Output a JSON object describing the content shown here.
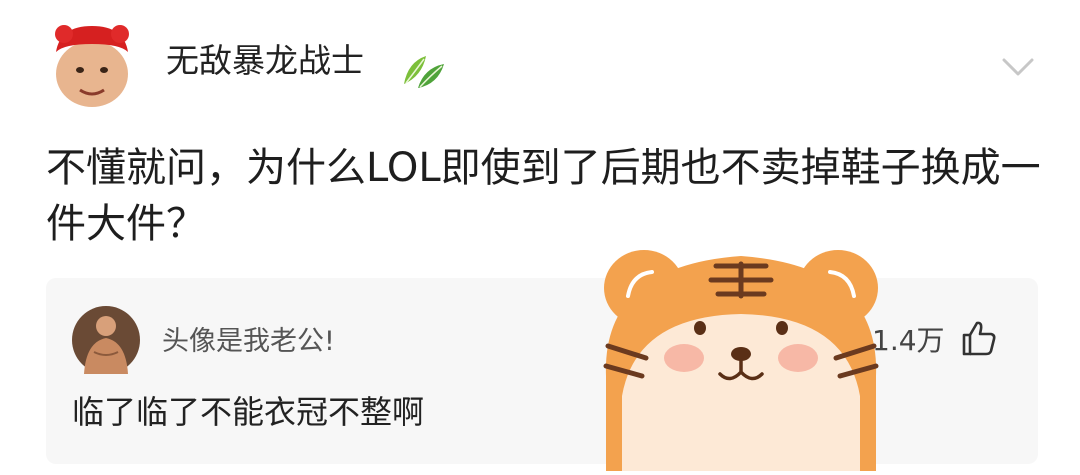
{
  "post": {
    "author": "无敌暴龙战士",
    "author_badge_icon": "leaf-badge-icon",
    "text": "不懂就问，为什么LOL即使到了后期也不卖掉鞋子换成一件大件？",
    "menu_icon": "chevron-down-icon"
  },
  "comment": {
    "author": "头像是我老公!",
    "text": "临了临了不能衣冠不整啊",
    "likes": "1.4万",
    "like_icon": "thumbs-up-icon"
  },
  "sticker": {
    "icon": "tiger-sticker"
  },
  "colors": {
    "background": "#ffffff",
    "card": "#f7f7f7",
    "tiger_orange": "#f3a24e",
    "tiger_face": "#fde9d6"
  }
}
